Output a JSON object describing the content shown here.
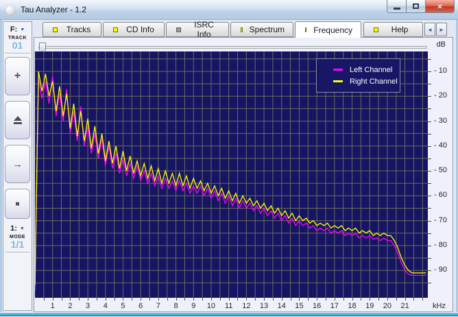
{
  "window": {
    "title": "Tau Analyzer - 1.2"
  },
  "titlebar": {
    "icons": {
      "app": "pearl-sphere",
      "minimize": "minimize-bar",
      "maximize": "maximize-box",
      "close": "×"
    }
  },
  "tabs": {
    "items": [
      {
        "label": "Tracks",
        "led": "yellow",
        "active": false
      },
      {
        "label": "CD Info",
        "led": "yellow",
        "active": false
      },
      {
        "label": "ISRC Info",
        "led": "gray",
        "active": false
      },
      {
        "label": "Spectrum",
        "led": "yellow",
        "active": false
      },
      {
        "label": "Frequency",
        "led": "yellow",
        "active": true
      },
      {
        "label": "Help",
        "led": "yellow",
        "active": false
      }
    ],
    "scroll_left_icon": "◄",
    "scroll_right_icon": "►"
  },
  "sidebar": {
    "drive_selector": {
      "value": "F:",
      "arrow_icon": "▼"
    },
    "track": {
      "label": "TRACK",
      "value": "01"
    },
    "buttons": [
      {
        "name": "add",
        "icon": "+"
      },
      {
        "name": "eject",
        "icon": "eject-shape"
      },
      {
        "name": "next",
        "icon": "→"
      },
      {
        "name": "stop",
        "icon": "■"
      }
    ],
    "mode_selector": {
      "value": "1:",
      "arrow_icon": "▼"
    },
    "mode": {
      "label": "MODE",
      "value": "1/1"
    }
  },
  "colors": {
    "plot_background": "#151563",
    "grid": "#6d6d5a",
    "left_channel": "#ff00ff",
    "right_channel": "#ffff00",
    "led_on": "#ffff00",
    "led_off": "#9a9a9a"
  },
  "chart_data": {
    "type": "line",
    "title": "",
    "x_axis": {
      "label": "kHz",
      "min": 0,
      "max": 22.3,
      "tick_step": 0.5,
      "label_step": 1,
      "grid_step": 0.5,
      "tick_labels": [
        "1",
        "2",
        "3",
        "4",
        "5",
        "6",
        "7",
        "8",
        "9",
        "10",
        "11",
        "12",
        "13",
        "14",
        "15",
        "16",
        "17",
        "18",
        "19",
        "20",
        "21"
      ]
    },
    "y_axis": {
      "label": "dB",
      "min": -100,
      "max": 0,
      "tick_step": 5,
      "grid_step": 5,
      "tick_labels": [
        "- 10",
        "- 20",
        "- 30",
        "- 40",
        "- 50",
        "- 60",
        "- 70",
        "- 80",
        "- 90"
      ],
      "label_values": [
        -10,
        -20,
        -30,
        -40,
        -50,
        -60,
        -70,
        -80,
        -90
      ]
    },
    "grid": true,
    "legend": {
      "position": "top-right",
      "entries": [
        {
          "label": "Left Channel",
          "color": "#ff00ff"
        },
        {
          "label": "Right Channel",
          "color": "#ffff00"
        }
      ]
    },
    "series": [
      {
        "name": "Left Channel",
        "color": "#ff00ff",
        "x_start": 0,
        "x_step": 0.2,
        "values": [
          -98,
          -13,
          -21,
          -14,
          -23,
          -12,
          -28,
          -19,
          -30,
          -17,
          -35,
          -26,
          -38,
          -24,
          -40,
          -32,
          -43,
          -35,
          -45,
          -37,
          -48,
          -40,
          -49,
          -43,
          -51,
          -45,
          -52,
          -47,
          -53,
          -48,
          -54,
          -50,
          -55,
          -51,
          -56,
          -52,
          -57,
          -53,
          -57,
          -54,
          -58,
          -54,
          -58,
          -55,
          -59,
          -56,
          -59,
          -56,
          -60,
          -57,
          -61,
          -58,
          -62,
          -59,
          -63,
          -60,
          -64,
          -61,
          -65,
          -62,
          -65,
          -63,
          -66,
          -64,
          -67,
          -65,
          -68,
          -66,
          -69,
          -67,
          -70,
          -68,
          -71,
          -69,
          -72,
          -70,
          -72,
          -71,
          -73,
          -72,
          -74,
          -73,
          -74,
          -73,
          -75,
          -74,
          -75,
          -74,
          -76,
          -75,
          -76,
          -75,
          -77,
          -76,
          -77,
          -76,
          -77.5,
          -77,
          -78,
          -77,
          -78,
          -78,
          -80,
          -83,
          -87,
          -90,
          -91.5,
          -92,
          -92,
          -92,
          -92,
          -92
        ]
      },
      {
        "name": "Right Channel",
        "color": "#ffff00",
        "x_start": 0,
        "x_step": 0.2,
        "values": [
          -96,
          -10,
          -18,
          -11,
          -20,
          -14,
          -26,
          -16,
          -28,
          -19,
          -33,
          -23,
          -36,
          -26,
          -38,
          -29,
          -41,
          -32,
          -43,
          -35,
          -46,
          -38,
          -47,
          -40,
          -49,
          -42,
          -50,
          -44,
          -51,
          -46,
          -52,
          -47,
          -53,
          -48,
          -54,
          -49,
          -55,
          -50,
          -55,
          -51,
          -56,
          -51,
          -56,
          -52,
          -57,
          -53,
          -57,
          -54,
          -58,
          -55,
          -59,
          -56,
          -60,
          -57,
          -61,
          -58,
          -62,
          -59,
          -63,
          -60,
          -63,
          -61,
          -64,
          -62,
          -65,
          -63,
          -66,
          -64,
          -67,
          -65,
          -68,
          -66,
          -69,
          -67,
          -70,
          -68,
          -70,
          -69,
          -71,
          -70,
          -72,
          -71,
          -72,
          -71,
          -73,
          -72,
          -73,
          -72,
          -74,
          -73,
          -74,
          -73,
          -75,
          -74,
          -75,
          -74,
          -76,
          -75,
          -76,
          -75,
          -76,
          -76,
          -78,
          -81,
          -85,
          -88,
          -90,
          -91,
          -91,
          -91,
          -91,
          -91
        ]
      }
    ]
  }
}
